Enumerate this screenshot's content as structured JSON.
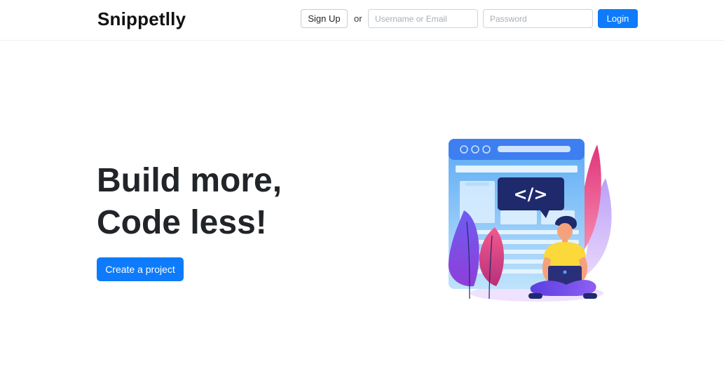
{
  "header": {
    "brand": "Snippetlly",
    "signup_label": "Sign Up",
    "or_text": "or",
    "username_placeholder": "Username or Email",
    "password_placeholder": "Password",
    "login_label": "Login"
  },
  "hero": {
    "title_line1": "Build more,",
    "title_line2": "Code less!",
    "cta_label": "Create a project",
    "illustration": {
      "code_symbol": "</>",
      "icon": "developer-coding-illustration"
    }
  },
  "colors": {
    "primary": "#0d7bfb",
    "text": "#212529",
    "browser_blue": "#5aa9f5",
    "code_bubble": "#1e2a6b",
    "leaf_pink": "#e0357a",
    "leaf_purple": "#7b5cf2",
    "shirt_yellow": "#fbd93a"
  }
}
